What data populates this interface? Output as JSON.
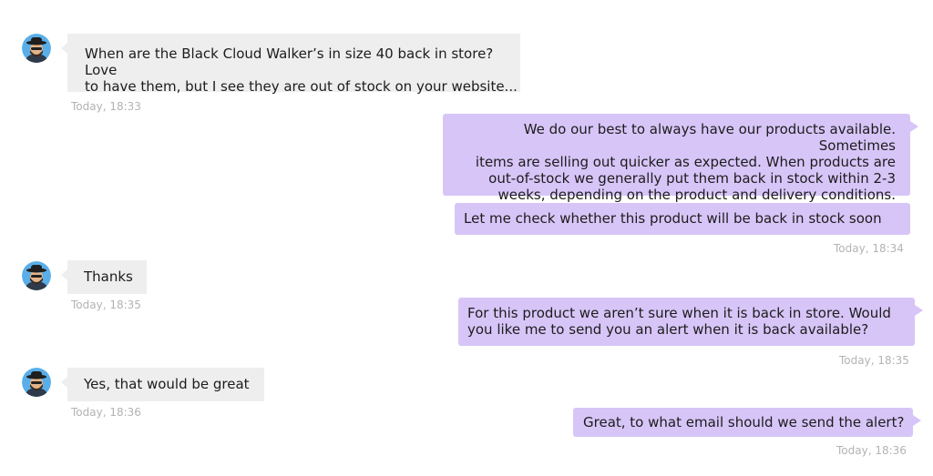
{
  "messages": [
    {
      "text_line1": "When are the Black Cloud Walker’s in size 40 back in store? Love",
      "text_line2": "to have them, but I see they are out of stock on your website...",
      "time": "Today, 18:33"
    },
    {
      "text_line1": "We do our best to always have our products available. Sometimes",
      "text_line2": "items are selling out quicker as expected. When products are",
      "text_line3": "out-of-stock we generally put them back in stock within 2-3",
      "text_line4": "weeks, depending on the product and delivery conditions."
    },
    {
      "text": "Let me check whether this product will be back in stock soon",
      "time": "Today, 18:34"
    },
    {
      "text": "Thanks",
      "time": "Today, 18:35"
    },
    {
      "text_line1": "For this product we aren’t sure when it is back in store. Would",
      "text_line2": "you like me to send you an alert when it is back available?",
      "time": "Today, 18:35"
    },
    {
      "text": "Yes, that would be great",
      "time": "Today, 18:36"
    },
    {
      "text": "Great, to what email should we send the alert?",
      "time": "Today, 18:36"
    }
  ],
  "colors": {
    "incoming_bubble": "#eeeeee",
    "outgoing_bubble": "#d7c5f8",
    "timestamp": "#b3b3b3",
    "avatar_bg": "#5aaee8"
  },
  "icons": {
    "avatar": "user-avatar-icon"
  }
}
